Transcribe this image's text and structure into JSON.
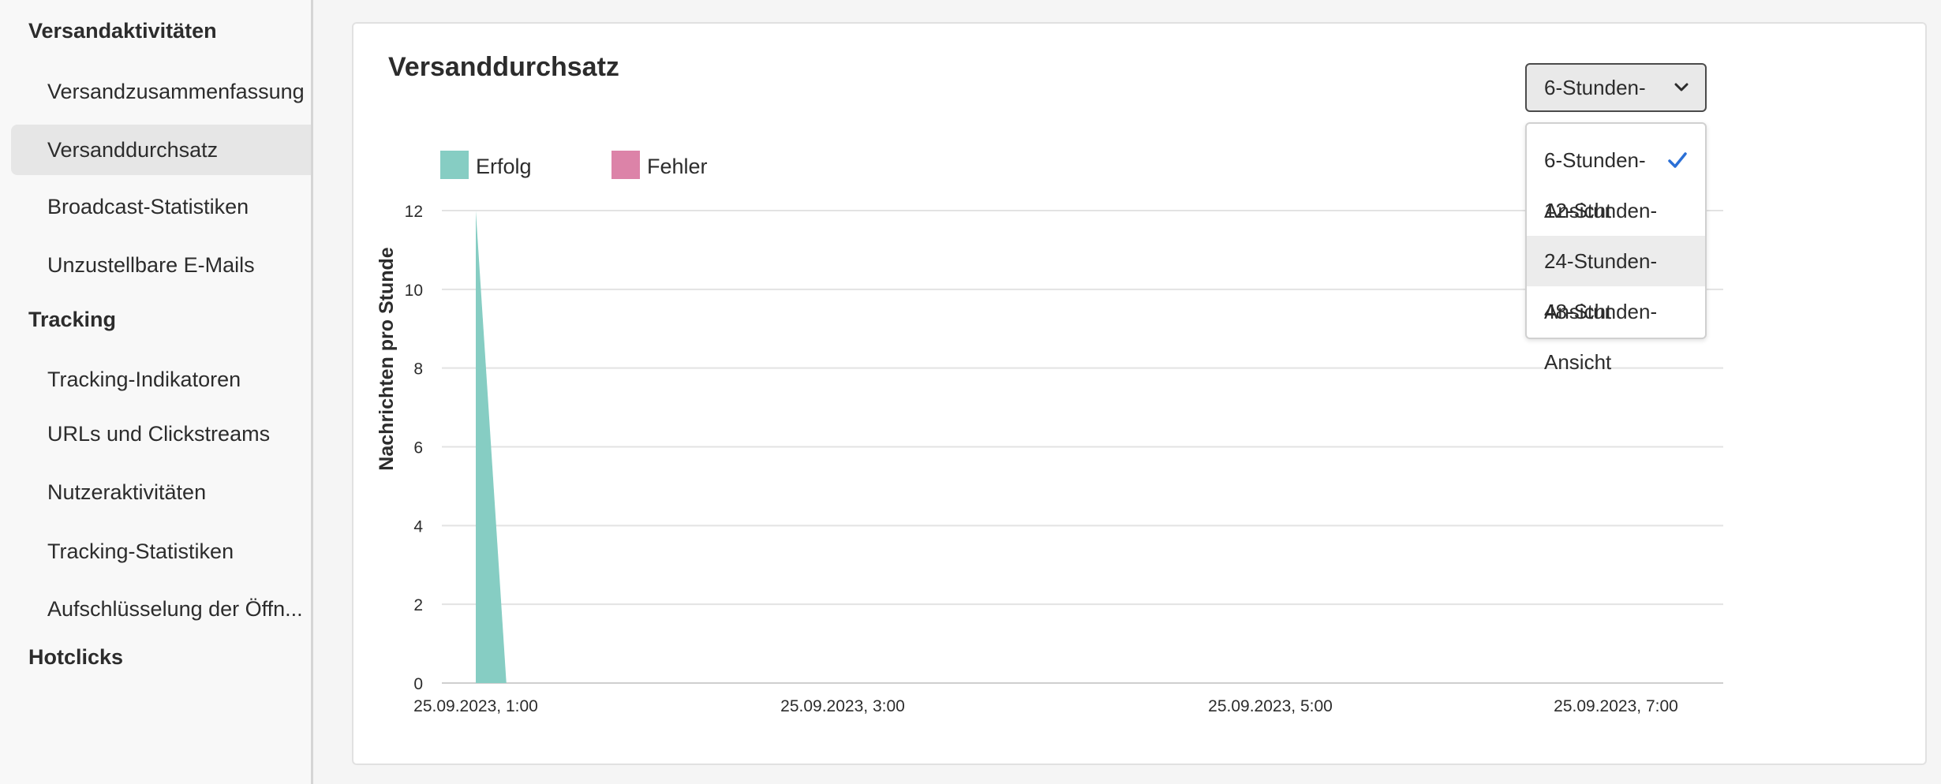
{
  "sidebar": {
    "sections": [
      {
        "title": "Versandaktivitäten",
        "items": [
          "Versandzusammenfassung",
          "Versanddurchsatz",
          "Broadcast-Statistiken",
          "Unzustellbare E-Mails"
        ]
      },
      {
        "title": "Tracking",
        "items": [
          "Tracking-Indikatoren",
          "URLs und Clickstreams",
          "Nutzeraktivitäten",
          "Tracking-Statistiken",
          "Aufschlüsselung der Öffn..."
        ]
      },
      {
        "title": "Hotclicks",
        "items": []
      }
    ],
    "active_item": "Versanddurchsatz"
  },
  "card": {
    "title": "Versanddurchsatz"
  },
  "view_picker": {
    "selected": "6-Stunden-Ansicht",
    "options": [
      "6-Stunden-Ansicht",
      "12-Stunden-Ansicht",
      "24-Stunden- Ansicht",
      "48-Stunden- Ansicht"
    ],
    "hovered": "24-Stunden- Ansicht"
  },
  "colors": {
    "success": "#86cdc3",
    "error": "#dc83a8",
    "check": "#2a6fd6"
  },
  "chart_data": {
    "type": "area",
    "ylabel": "Nachrichten pro Stunde",
    "xlabel": "",
    "ylim": [
      0,
      12
    ],
    "yticks": [
      0,
      2,
      4,
      6,
      8,
      10,
      12
    ],
    "xticks": [
      "25.09.2023, 1:00",
      "25.09.2023, 3:00",
      "25.09.2023, 5:00",
      "25.09.2023, 7:00"
    ],
    "legend_position": "top-left",
    "grid": true,
    "series": [
      {
        "name": "Erfolg",
        "points": [
          {
            "x": "25.09.2023, 1:00",
            "y": 12
          },
          {
            "x": "25.09.2023, 1:10",
            "y": 0
          }
        ]
      },
      {
        "name": "Fehler",
        "points": []
      }
    ]
  }
}
